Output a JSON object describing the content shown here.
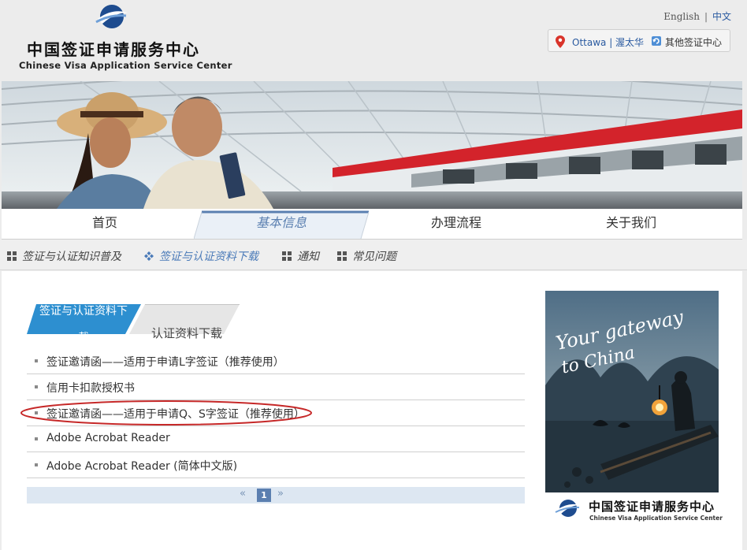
{
  "header": {
    "logo_cn": "中国签证申请服务中心",
    "logo_en": "Chinese Visa Application Service Center",
    "lang_en": "English",
    "lang_sep": "|",
    "lang_cn": "中文",
    "city": "Ottawa | 渥太华",
    "other_centers": "其他签证中心"
  },
  "mainnav": {
    "items": [
      "首页",
      "基本信息",
      "办理流程",
      "关于我们"
    ]
  },
  "subnav": {
    "items": [
      "签证与认证知识普及",
      "签证与认证资料下载",
      "通知",
      "常见问题"
    ]
  },
  "tabs": {
    "active": "签证与认证资料下载",
    "inactive": "认证资料下载"
  },
  "downloads": [
    "签证邀请函——适用于申请L字签证（推荐使用）",
    "信用卡扣款授权书",
    "签证邀请函——适用于申请Q、S字签证（推荐使用）",
    "Adobe Acrobat Reader",
    "Adobe Acrobat Reader (简体中文版)"
  ],
  "pager": {
    "prev": "«",
    "page": "1",
    "next": "»"
  },
  "ad": {
    "headline_line1": "Your gateway",
    "headline_line2": "to China",
    "logo_cn": "中国签证申请服务中心",
    "logo_en": "Chinese Visa Application Service Center"
  },
  "colors": {
    "accent": "#4a7ab8",
    "highlight": "#c62828"
  }
}
